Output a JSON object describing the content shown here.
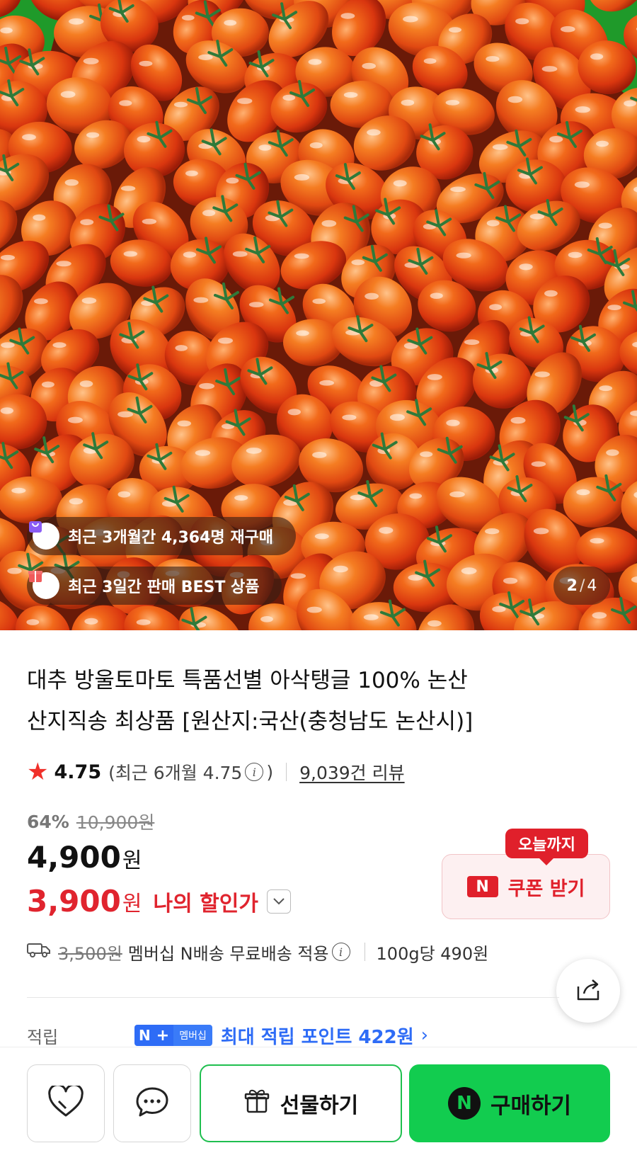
{
  "gallery": {
    "badges": [
      {
        "text": "최근 3개월간 4,364명 재구매",
        "icon": "repurchase-bag-icon"
      },
      {
        "text": "최근 3일간 판매 BEST 상품",
        "icon": "gift-box-icon"
      }
    ],
    "pager": {
      "current": "2",
      "separator": "/",
      "total": "4"
    }
  },
  "product": {
    "title_line1": "대추 방울토마토 특품선별 아삭탱글 100% 논산",
    "title_line2": "산지직송 최상품 [원산지:국산(충청남도 논산시)]"
  },
  "rating": {
    "score": "4.75",
    "recent_prefix": "(최근 6개월 4.75",
    "recent_suffix": ")",
    "info_glyph": "i",
    "review_link": "9,039건 리뷰"
  },
  "price": {
    "discount_rate": "64%",
    "original": "10,900원",
    "sale_number": "4,900",
    "sale_unit": "원",
    "my_number": "3,900",
    "my_unit": "원",
    "my_label": "나의 할인가"
  },
  "coupon": {
    "tag": "오늘까지",
    "badge": "N",
    "label": "쿠폰 받기"
  },
  "shipping": {
    "original_fee": "3,500원",
    "text": "멤버십 N배송 무료배송 적용",
    "unit_price": "100g당 490원"
  },
  "points": {
    "label": "적립",
    "badge_n": "N",
    "badge_plus": "+",
    "badge_member": "멤버십",
    "text": "최대 적립 포인트 422원",
    "chevron": "›"
  },
  "actions": {
    "gift_label": "선물하기",
    "buy_badge": "N",
    "buy_label": "구매하기"
  },
  "colors": {
    "accent_red": "#e0242e",
    "buy_green": "#12cc4f",
    "point_blue": "#2e6cf6",
    "star": "#f0302a"
  }
}
